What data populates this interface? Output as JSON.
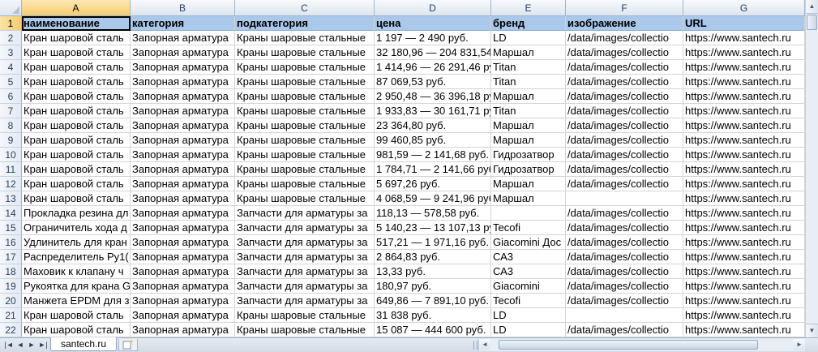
{
  "columns": [
    "A",
    "B",
    "C",
    "D",
    "E",
    "F",
    "G"
  ],
  "row_numbers": [
    "1",
    "2",
    "3",
    "4",
    "5",
    "6",
    "7",
    "8",
    "9",
    "10",
    "11",
    "12",
    "13",
    "14",
    "15",
    "16",
    "17",
    "18",
    "19",
    "20",
    "21",
    "22"
  ],
  "rows": [
    [
      "наименование",
      "категория",
      "подкатегория",
      "цена",
      "бренд",
      "изображение",
      "URL"
    ],
    [
      "Кран шаровой сталь",
      "Запорная арматура",
      "Краны шаровые стальные",
      "1 197 — 2 490 руб.",
      "LD",
      "/data/images/collectio",
      "https://www.santech.ru"
    ],
    [
      "Кран шаровой сталь",
      "Запорная арматура",
      "Краны шаровые стальные",
      "32 180,96 — 204 831,54",
      "Маршал",
      "/data/images/collectio",
      "https://www.santech.ru"
    ],
    [
      "Кран шаровой сталь",
      "Запорная арматура",
      "Краны шаровые стальные",
      "1 414,96 — 26 291,46 ру",
      "Titan",
      "/data/images/collectio",
      "https://www.santech.ru"
    ],
    [
      "Кран шаровой сталь",
      "Запорная арматура",
      "Краны шаровые стальные",
      "87 069,53 руб.",
      "Titan",
      "/data/images/collectio",
      "https://www.santech.ru"
    ],
    [
      "Кран шаровой сталь",
      "Запорная арматура",
      "Краны шаровые стальные",
      "2 950,48 — 36 396,18 ру",
      "Маршал",
      "/data/images/collectio",
      "https://www.santech.ru"
    ],
    [
      "Кран шаровой сталь",
      "Запорная арматура",
      "Краны шаровые стальные",
      "1 933,83 — 30 161,71 ру",
      "Titan",
      "/data/images/collectio",
      "https://www.santech.ru"
    ],
    [
      "Кран шаровой сталь",
      "Запорная арматура",
      "Краны шаровые стальные",
      "23 364,80 руб.",
      "Маршал",
      "/data/images/collectio",
      "https://www.santech.ru"
    ],
    [
      "Кран шаровой сталь",
      "Запорная арматура",
      "Краны шаровые стальные",
      "99 460,85 руб.",
      "Маршал",
      "/data/images/collectio",
      "https://www.santech.ru"
    ],
    [
      "Кран шаровой сталь",
      "Запорная арматура",
      "Краны шаровые стальные",
      "981,59 — 2 141,68 руб.",
      "Гидрозатвор",
      "/data/images/collectio",
      "https://www.santech.ru"
    ],
    [
      "Кран шаровой сталь",
      "Запорная арматура",
      "Краны шаровые стальные",
      "1 784,71 — 2 141,66 руб",
      "Гидрозатвор",
      "/data/images/collectio",
      "https://www.santech.ru"
    ],
    [
      "Кран шаровой сталь",
      "Запорная арматура",
      "Краны шаровые стальные",
      "5 697,26 руб.",
      "Маршал",
      "/data/images/collectio",
      "https://www.santech.ru"
    ],
    [
      "Кран шаровой сталь",
      "Запорная арматура",
      "Краны шаровые стальные",
      "4 068,59 — 9 241,96 руб",
      "Маршал",
      "",
      "https://www.santech.ru"
    ],
    [
      "Прокладка резина дл",
      "Запорная арматура",
      "Запчасти для арматуры за",
      "118,13 — 578,58 руб.",
      "",
      "/data/images/collectio",
      "https://www.santech.ru"
    ],
    [
      "Ограничитель хода д",
      "Запорная арматура",
      "Запчасти для арматуры за",
      "5 140,23 — 13 107,13 ру",
      "Tecofi",
      "/data/images/collectio",
      "https://www.santech.ru"
    ],
    [
      "Удлинитель для кран",
      "Запорная арматура",
      "Запчасти для арматуры за",
      "517,21 — 1 971,16 руб.",
      "Giacomini Дос",
      "/data/images/collectio",
      "https://www.santech.ru"
    ],
    [
      "Распределитель Ру1(",
      "Запорная арматура",
      "Запчасти для арматуры за",
      "2 864,83 руб.",
      "СА3",
      "/data/images/collectio",
      "https://www.santech.ru"
    ],
    [
      "Маховик к клапану ч",
      "Запорная арматура",
      "Запчасти для арматуры за",
      "13,33 руб.",
      "СА3",
      "/data/images/collectio",
      "https://www.santech.ru"
    ],
    [
      "Рукоятка для крана G",
      "Запорная арматура",
      "Запчасти для арматуры за",
      "180,97 руб.",
      "Giacomini",
      "/data/images/collectio",
      "https://www.santech.ru"
    ],
    [
      "Манжета EPDM для з",
      "Запорная арматура",
      "Запчасти для арматуры за",
      "649,86 — 7 891,10 руб.",
      "Tecofi",
      "/data/images/collectio",
      "https://www.santech.ru"
    ],
    [
      "Кран шаровой сталь",
      "Запорная арматура",
      "Краны шаровые стальные",
      "31 838 руб.",
      "LD",
      "",
      "https://www.santech.ru"
    ],
    [
      "Кран шаровой сталь",
      "Запорная арматура",
      "Краны шаровые стальные",
      "15 087 — 444 600 руб.",
      "LD",
      "/data/images/collectio",
      "https://www.santech.ru"
    ]
  ],
  "sheet_tab": "santech.ru",
  "icons": {
    "nav_first": "first-sheet-icon",
    "nav_prev": "prev-sheet-icon",
    "nav_next": "next-sheet-icon",
    "nav_last": "last-sheet-icon",
    "new_sheet": "new-sheet-icon",
    "scroll_up": "arrow-up-icon",
    "scroll_down": "arrow-down-icon",
    "scroll_left": "arrow-left-icon",
    "scroll_right": "arrow-right-icon"
  },
  "colors": {
    "header_fill": "#a9c8ea",
    "gridline": "#d4d4d4",
    "selection": "#f6cc6f"
  },
  "active_cell": "A1"
}
